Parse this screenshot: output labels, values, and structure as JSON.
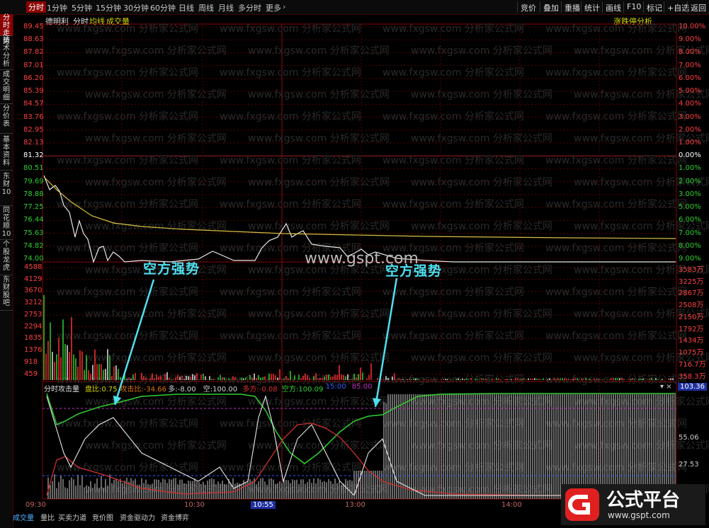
{
  "topbar": {
    "tabs": [
      "分时",
      "1分钟",
      "5分钟",
      "15分钟",
      "30分钟",
      "60分钟",
      "日线",
      "周线",
      "月线",
      "多分时",
      "更多"
    ],
    "right_buttons": [
      "竞价",
      "叠加",
      "重播",
      "统计",
      "画线",
      "F10",
      "标记",
      "+自选",
      "返回"
    ]
  },
  "sidebar": {
    "items": [
      "分时走势",
      "技术分析",
      "成交明细",
      "分价表",
      "基本资料",
      "东财10",
      "同花顺10",
      "个股龙虎",
      "东财股吧"
    ]
  },
  "chart_header": {
    "name": "德明利",
    "mode": "分时",
    "avg_label": "均线",
    "vol_label": "成交量",
    "right_link": "涨跌停分析"
  },
  "price_axis": {
    "left": [
      "89.45",
      "88.63",
      "87.82",
      "87.01",
      "86.20",
      "85.39",
      "84.57",
      "83.76",
      "82.95",
      "82.13",
      "81.32",
      "80.51",
      "79.69",
      "78.88",
      "77.25",
      "76.44",
      "75.63",
      "74.82",
      "74.00"
    ],
    "right": [
      "10.00%",
      "9.00%",
      "8.00%",
      "7.00%",
      "6.00%",
      "5.00%",
      "4.00%",
      "3.00%",
      "2.00%",
      "1.00%",
      "0.00%",
      "1.00%",
      "2.00%",
      "3.00%",
      "5.00%",
      "6.00%",
      "7.00%",
      "8.00%",
      "9.00%"
    ]
  },
  "volume_axis": {
    "left": [
      "4588",
      "4129",
      "3670",
      "3212",
      "2753",
      "2294",
      "1835",
      "1376",
      "918",
      "459"
    ],
    "right": [
      "3583万",
      "3225万",
      "2867万",
      "2508万",
      "2150万",
      "1792万",
      "1434万",
      "1075万",
      "716.7万",
      "358.3万"
    ]
  },
  "indicator": {
    "name": "分时攻击量",
    "items": [
      {
        "label": "盘比",
        "value": "0.75",
        "color": "#d8d800"
      },
      {
        "label": "攻击比",
        "value": "-34.66",
        "color": "#e07800"
      },
      {
        "label": "多",
        "value": "-8.00",
        "color": "#d0d0d0"
      },
      {
        "label": "空",
        "value": "100.00",
        "color": "#d0d0d0"
      },
      {
        "label": "多方",
        "value": "-0.08",
        "color": "#e03030"
      },
      {
        "label": "空方",
        "value": "100.09",
        "color": "#30d030"
      },
      {
        "label": "",
        "value": "15:00",
        "color": "#3060ff"
      },
      {
        "label": "",
        "value": "85.00",
        "color": "#c030c0"
      }
    ],
    "top_right_value": "103.36",
    "axis": [
      "55.06",
      "27.53"
    ]
  },
  "time_axis": [
    "09:30",
    "10:30",
    "10:55",
    "13:00",
    "14:00"
  ],
  "bottom_tabs": [
    "成交量",
    "量比",
    "买卖力道",
    "竞价图",
    "资金驱动力",
    "资金博弈"
  ],
  "annotations": [
    "空方强势",
    "空方强势"
  ],
  "watermarks": [
    "www.fxgsw.com",
    "分析家公式网",
    "www.gspt.com"
  ],
  "logo": {
    "text": "公式平台",
    "url": "www.gspt.com"
  },
  "colors": {
    "up": "#ff3030",
    "down": "#30d030",
    "avg": "#d8c040",
    "price": "#e8e8e8",
    "grid": "#5a0000",
    "cyan": "#4fe0f0"
  }
}
